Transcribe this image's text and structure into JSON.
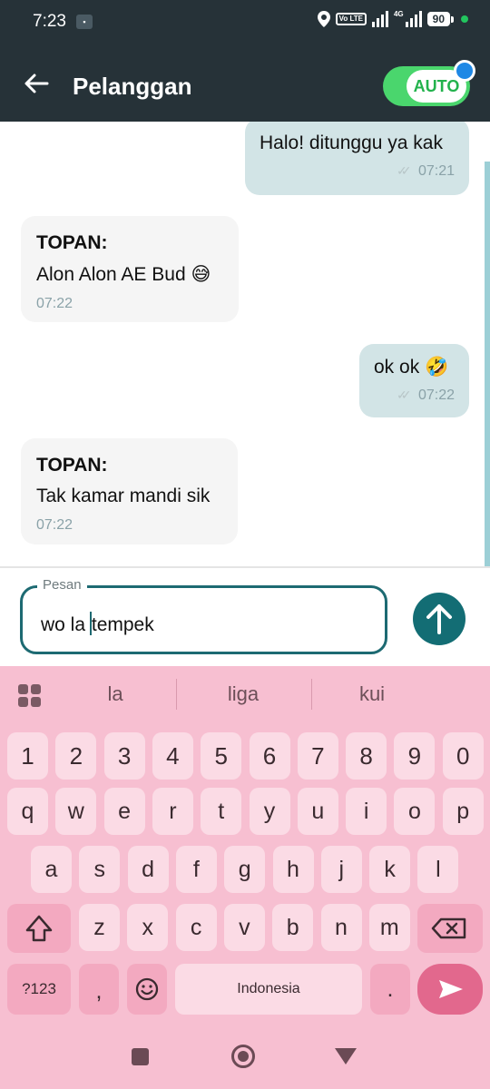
{
  "status_bar": {
    "time": "7:23",
    "network": "4G",
    "volte": "Vo LTE",
    "battery": "90"
  },
  "header": {
    "title": "Pelanggan",
    "toggle_label": "AUTO"
  },
  "messages": [
    {
      "direction": "out",
      "text": "Halo! ditunggu ya kak",
      "time": "07:21"
    },
    {
      "direction": "in",
      "sender": "TOPAN:",
      "text": "Alon Alon AE Bud 😅",
      "time": "07:22"
    },
    {
      "direction": "out",
      "text": "ok ok 🤣",
      "time": "07:22"
    },
    {
      "direction": "in",
      "sender": "TOPAN:",
      "text": "Tak kamar mandi sik",
      "time": "07:22"
    }
  ],
  "composer": {
    "label": "Pesan",
    "value_before_cursor": "wo la ",
    "value_after_cursor": "tempek"
  },
  "keyboard": {
    "suggestions": [
      "la",
      "liga",
      "kui"
    ],
    "row_numbers": [
      "1",
      "2",
      "3",
      "4",
      "5",
      "6",
      "7",
      "8",
      "9",
      "0"
    ],
    "row_1": [
      "q",
      "w",
      "e",
      "r",
      "t",
      "y",
      "u",
      "i",
      "o",
      "p"
    ],
    "row_2": [
      "a",
      "s",
      "d",
      "f",
      "g",
      "h",
      "j",
      "k",
      "l"
    ],
    "row_3": [
      "z",
      "x",
      "c",
      "v",
      "b",
      "n",
      "m"
    ],
    "symbols_key": "?123",
    "comma_key": ",",
    "space_label": "Indonesia",
    "period_key": "."
  },
  "colors": {
    "header_bg": "#263238",
    "toggle_green": "#4ad66d",
    "outgoing_bubble": "#d2e4e6",
    "incoming_bubble": "#f5f5f5",
    "accent_teal": "#136d74",
    "keyboard_bg": "#f7bfd1",
    "enter_key": "#e2688d"
  }
}
